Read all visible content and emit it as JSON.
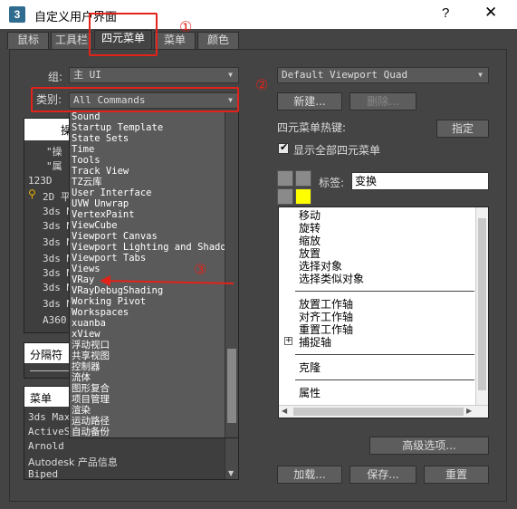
{
  "window": {
    "title": "自定义用户界面",
    "icon_label": "3",
    "help": "?",
    "close": "✕"
  },
  "tabs": [
    "鼠标",
    "工具栏",
    "四元菜单",
    "菜单",
    "颜色"
  ],
  "group": {
    "label": "组:",
    "value": "主 UI"
  },
  "category": {
    "label": "类别:",
    "value": "All Commands"
  },
  "left_list": {
    "header": "操",
    "items": [
      "\"操",
      "\"属",
      "123D",
      "2D 平",
      "3ds M",
      "3ds M",
      "3ds M",
      "3ds M",
      "3ds M",
      "3ds M",
      "3ds M",
      "A360",
      "..."
    ]
  },
  "separator_list": {
    "item": "分隔符"
  },
  "menu_list": {
    "header": "菜单",
    "items": [
      "3ds Max",
      "ActiveS",
      "Arnold",
      "Autodesk 产品信息",
      "Biped"
    ]
  },
  "dropdown": {
    "items": [
      "Sound",
      "Startup Template",
      "State Sets",
      "Time",
      "Tools",
      "Track View",
      "TZ云库",
      "User Interface",
      "UVW Unwrap",
      "VertexPaint",
      "ViewCube",
      "Viewport Canvas",
      "Viewport Lighting and Shadows",
      "Viewport Tabs",
      "Views",
      "VRay",
      "VRayDebugShading",
      "Working Pivot",
      "Workspaces",
      "xuanba",
      "xView",
      "浮动视口",
      "共享视图",
      "控制器",
      "流体",
      "图形复合",
      "项目管理",
      "渲染",
      "运动路径",
      "自动备份"
    ]
  },
  "quad": {
    "value": "Default Viewport Quad",
    "new_label": "新建...",
    "delete_label": "删除...",
    "hotkey_label": "四元菜单热键:",
    "assign_label": "指定",
    "show_all_label": "显示全部四元菜单",
    "show_all_checked": true,
    "tag_label": "标签:",
    "tag_value": "变换",
    "active_quad_color": "#ffff00"
  },
  "tree": {
    "items": [
      "移动",
      "旋转",
      "缩放",
      "放置",
      "选择对象",
      "选择类似对象",
      "放置工作轴",
      "对齐工作轴",
      "重置工作轴",
      "捕捉轴",
      "克隆",
      "属性"
    ],
    "expander": "+"
  },
  "buttons": {
    "advanced": "高级选项...",
    "load": "加载...",
    "save": "保存...",
    "reset": "重置"
  },
  "annotations": {
    "one": "①",
    "two": "②",
    "three": "③"
  }
}
